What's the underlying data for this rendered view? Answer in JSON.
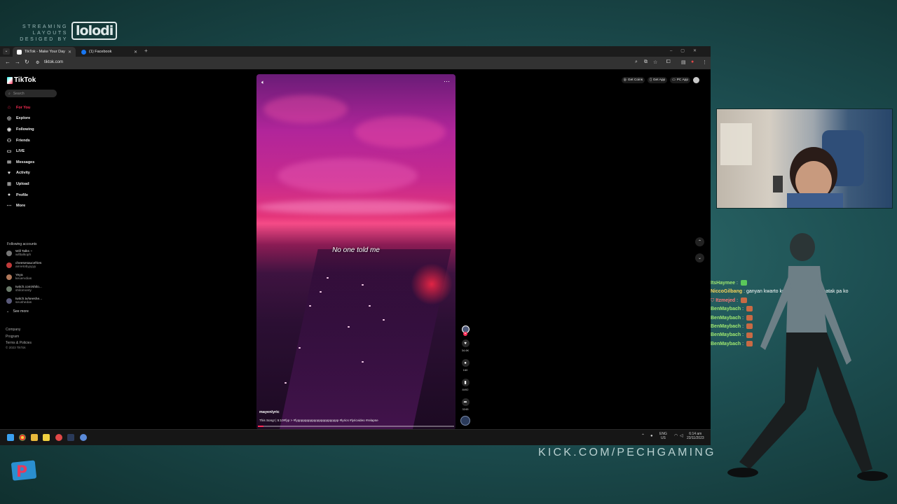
{
  "overlay": {
    "brand_small": "STREAMING LAYOUTS DESIGED BY",
    "brand_logo": "lolodi",
    "kick_url": "KICK.COM/PECHGAMING"
  },
  "chat": [
    {
      "user": "ItsHaymee",
      "sep": " : ",
      "text": "",
      "color": "#9fe870",
      "emote": "green"
    },
    {
      "user": "NiccoGilbang",
      "sep": " : ",
      "text": "ganyan kwarto ko noon nung bumabatak pa ko",
      "color": "#f7d358",
      "emote": ""
    },
    {
      "user": "Itzmejed",
      "sep": " : ",
      "text": "",
      "color": "#ff7777",
      "emote": "brown"
    },
    {
      "user": "BenMaybach",
      "sep": " : ",
      "text": "",
      "color": "#9fe870",
      "emote": "brown"
    },
    {
      "user": "BenMaybach",
      "sep": " : ",
      "text": "",
      "color": "#9fe870",
      "emote": "brown"
    },
    {
      "user": "BenMaybach",
      "sep": " : ",
      "text": "",
      "color": "#9fe870",
      "emote": "brown"
    },
    {
      "user": "BenMaybach",
      "sep": " : ",
      "text": "",
      "color": "#9fe870",
      "emote": "brown"
    },
    {
      "user": "BenMaybach",
      "sep": " : ",
      "text": "",
      "color": "#9fe870",
      "emote": "brown"
    }
  ],
  "browser": {
    "tabs": [
      {
        "label": "TikTok - Make Your Day",
        "active": true
      },
      {
        "label": "(1) Facebook",
        "active": false
      }
    ],
    "url": "tiktok.com"
  },
  "tiktok": {
    "logo": "TikTok",
    "search_placeholder": "Search",
    "nav": [
      {
        "label": "For You",
        "icon": "home-icon",
        "glyph": "⌂",
        "active": true
      },
      {
        "label": "Explore",
        "icon": "compass-icon",
        "glyph": "◎",
        "active": false
      },
      {
        "label": "Following",
        "icon": "following-icon",
        "glyph": "◉",
        "active": false
      },
      {
        "label": "Friends",
        "icon": "friends-icon",
        "glyph": "⚇",
        "active": false
      },
      {
        "label": "LIVE",
        "icon": "live-icon",
        "glyph": "▭",
        "active": false
      },
      {
        "label": "Messages",
        "icon": "messages-icon",
        "glyph": "✉",
        "active": false
      },
      {
        "label": "Activity",
        "icon": "activity-icon",
        "glyph": "♥",
        "active": false
      },
      {
        "label": "Upload",
        "icon": "upload-icon",
        "glyph": "⊞",
        "active": false
      },
      {
        "label": "Profile",
        "icon": "profile-icon",
        "glyph": "●",
        "active": false
      },
      {
        "label": "More",
        "icon": "more-icon",
        "glyph": "⋯",
        "active": false
      }
    ],
    "following_title": "Following accounts",
    "following": [
      {
        "name": "Will Talks ~",
        "handle": "willtalkoph"
      },
      {
        "name": "cheesesaucefries",
        "handle": "annetobyyyyy"
      },
      {
        "name": "Yeya",
        "handle": "keuervdias"
      },
      {
        "name": "twitch.com/shilo...",
        "handle": "shilomonty"
      },
      {
        "name": "twitch.tv/seeshe...",
        "handle": "seushedas"
      }
    ],
    "see_more": "See more",
    "footer": [
      "Company",
      "Program",
      "Terms & Policies"
    ],
    "copyright": "© 2023 TikTok",
    "top_actions": [
      "Get Coins",
      "Get App",
      "PC App"
    ],
    "video": {
      "caption": "No one told me",
      "username": "mayenlyric",
      "description": "This Song! | 5:10#fyp > #fyppppppppppppppppppppppp #lyrics #lyricvideo #relapse",
      "likes": "34.6K",
      "comments": "160",
      "saves": "8492",
      "shares": "3245",
      "progress": 0.03
    }
  },
  "taskbar": {
    "lang": "ENG",
    "region": "US",
    "time": "6:14 am",
    "date": "23/11/2023"
  }
}
